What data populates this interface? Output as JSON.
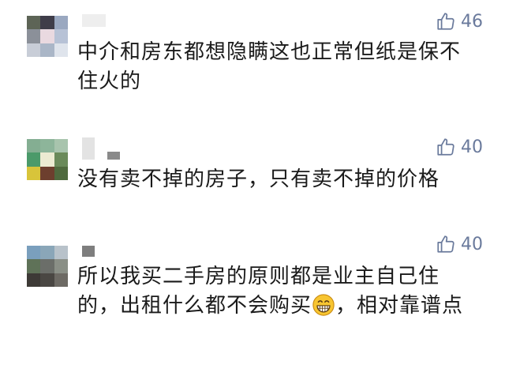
{
  "comments": [
    {
      "likes": "46",
      "text": "中介和房东都想隐瞒这也正常但纸是保不住火的"
    },
    {
      "likes": "40",
      "text": "没有卖不掉的房子，只有卖不掉的价格"
    },
    {
      "likes": "40",
      "text_before": "所以我买二手房的原则都是业主自己住的，出租什么都不会购买",
      "emoji": "grinning-face-emoji",
      "text_after": "，相对靠谱点"
    }
  ],
  "colors": {
    "like": "#6a7a9c",
    "text": "#1a1a1a"
  }
}
